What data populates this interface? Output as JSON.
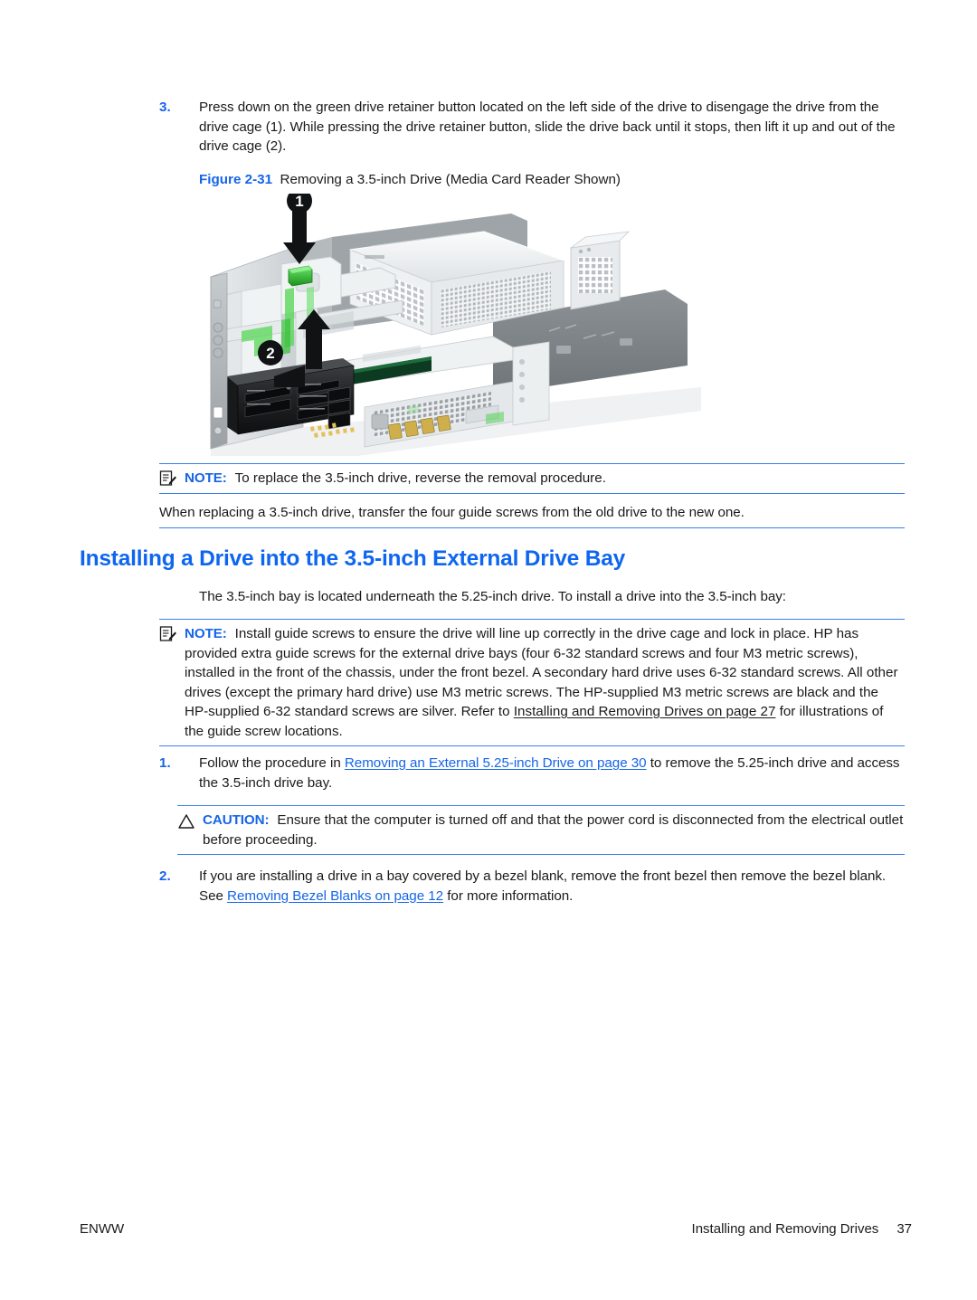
{
  "document": {
    "language_code": "ENWW",
    "page_number": "37",
    "running_head": "Installing and Removing Drives"
  },
  "steps_top": {
    "marker": "3.",
    "text": "Press down on the green drive retainer button located on the left side of the drive to disengage the drive from the drive cage (1). While pressing the drive retainer button, slide the drive back until it stops, then lift it up and out of the drive cage (2)."
  },
  "figure": {
    "label": "Figure 2-31",
    "title": "Removing a 3.5-inch Drive (Media Card Reader Shown)",
    "callouts": [
      {
        "number": "1",
        "meaning": "press-green-drive-retainer-button-down"
      },
      {
        "number": "2",
        "meaning": "slide-drive-back-and-lift-up"
      }
    ],
    "alt": "Desktop computer chassis with top cover removed, showing the power supply, drive cage, media card reader in the 3.5-inch external bay, green drive retainer button, and rear I/O ports."
  },
  "note_replace": {
    "icon": "note-icon",
    "keyword": "NOTE:",
    "text": "To replace the 3.5-inch drive, reverse the removal procedure."
  },
  "guide_screws_note": {
    "text": "When replacing a 3.5-inch drive, transfer the four guide screws from the old drive to the new one."
  },
  "heading": {
    "title": "Installing a Drive into the 3.5-inch External Drive Bay"
  },
  "intro": {
    "text": "The 3.5-inch bay is located underneath the 5.25-inch drive. To install a drive into the 3.5-inch bay:"
  },
  "note_guide_screws": {
    "icon": "note-icon",
    "keyword": "NOTE:",
    "text_before_link": "Install guide screws to ensure the drive will line up correctly in the drive cage and lock in place. HP has provided extra guide screws for the external drive bays (four 6-32 standard screws and four M3 metric screws), installed in the front of the chassis, under the front bezel. A secondary hard drive uses 6-32 standard screws. All other drives (except the primary hard drive) use M3 metric screws. The HP-supplied M3 metric screws are black and the HP-supplied 6-32 standard screws are silver. Refer to ",
    "link_text": "Installing and Removing Drives on page 27",
    "text_after_link": " for illustrations of the guide screw locations."
  },
  "step_1": {
    "marker": "1.",
    "text_before_link": "Follow the procedure in ",
    "link_text": "Removing an External 5.25-inch Drive on page 30",
    "text_after_link": " to remove the 5.25-inch drive and access the 3.5-inch drive bay."
  },
  "caution": {
    "icon": "caution-triangle-icon",
    "keyword": "CAUTION:",
    "text": "Ensure that the computer is turned off and that the power cord is disconnected from the electrical outlet before proceeding."
  },
  "step_2": {
    "marker": "2.",
    "text_before_link": "If you are installing a drive in a bay covered by a bezel blank, remove the front bezel then remove the bezel blank. See ",
    "link_text": "Removing Bezel Blanks on page 12",
    "text_after_link": " for more information."
  },
  "colors": {
    "heading_blue": "#0E66F0",
    "link_blue": "#1565E8",
    "rule_blue": "#3C80E8",
    "body_black": "#1a1a1a",
    "retainer_green": "#3FBF3F",
    "callout_black": "#111111"
  }
}
